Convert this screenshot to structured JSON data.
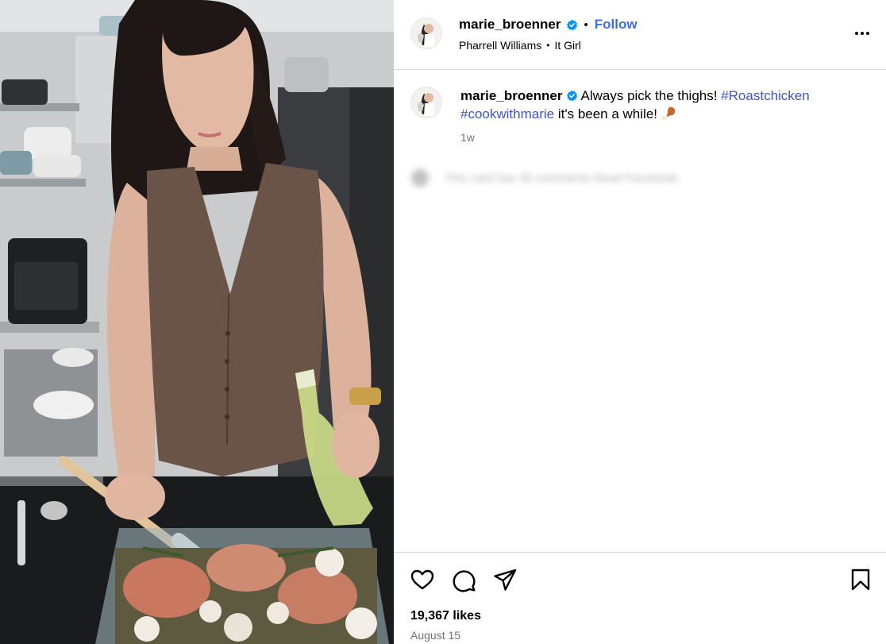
{
  "post": {
    "username": "marie_broenner",
    "verified": true,
    "follow_label": "Follow",
    "header_separator": "•",
    "audio": "Pharrell Williams",
    "audio_separator": "•",
    "audio_track": "It Girl",
    "more_icon": "more-horizontal-icon"
  },
  "caption": {
    "username": "marie_broenner",
    "text_before": "Always pick the thighs!",
    "hashtag_1": "#Roastchicken",
    "hashtag_2": "#cookwithmarie",
    "text_after": "it's been a while!",
    "emoji_icon": "poultry-leg-icon",
    "time_ago": "1w"
  },
  "blurred_notice": {
    "text": "This card has 3k comments Read Facebook"
  },
  "actions": {
    "like_icon": "heart-icon",
    "comment_icon": "comment-icon",
    "share_icon": "share-icon",
    "save_icon": "bookmark-icon"
  },
  "stats": {
    "likes": "19,367 likes",
    "date": "August 15"
  },
  "colors": {
    "link_blue": "#3f6fd8",
    "hashtag": "#3f55c8",
    "verified_badge": "#0095f6",
    "muted_text": "#737373",
    "divider": "#dbdbdb"
  }
}
